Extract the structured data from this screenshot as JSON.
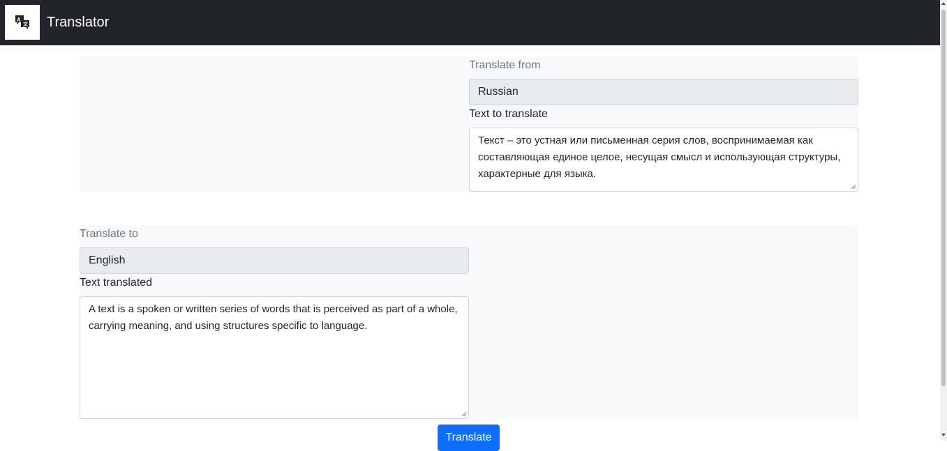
{
  "app": {
    "title": "Translator",
    "logo_icon": "translate-icon"
  },
  "source": {
    "language_label": "Translate from",
    "language_value": "Russian",
    "text_label": "Text to translate",
    "text_value": "Текст – это устная или письменная серия слов, воспринимаемая как составляющая единое целое, несущая смысл и использующая структуры, характерные для языка."
  },
  "target": {
    "language_label": "Translate to",
    "language_value": "English",
    "text_label": "Text translated",
    "text_value": "A text is a spoken or written series of words that is perceived as part of a whole, carrying meaning, and using structures specific to language."
  },
  "actions": {
    "translate_label": "Translate"
  },
  "colors": {
    "navbar": "#212529",
    "panel": "#f8f9fa",
    "primary": "#0d6efd"
  }
}
